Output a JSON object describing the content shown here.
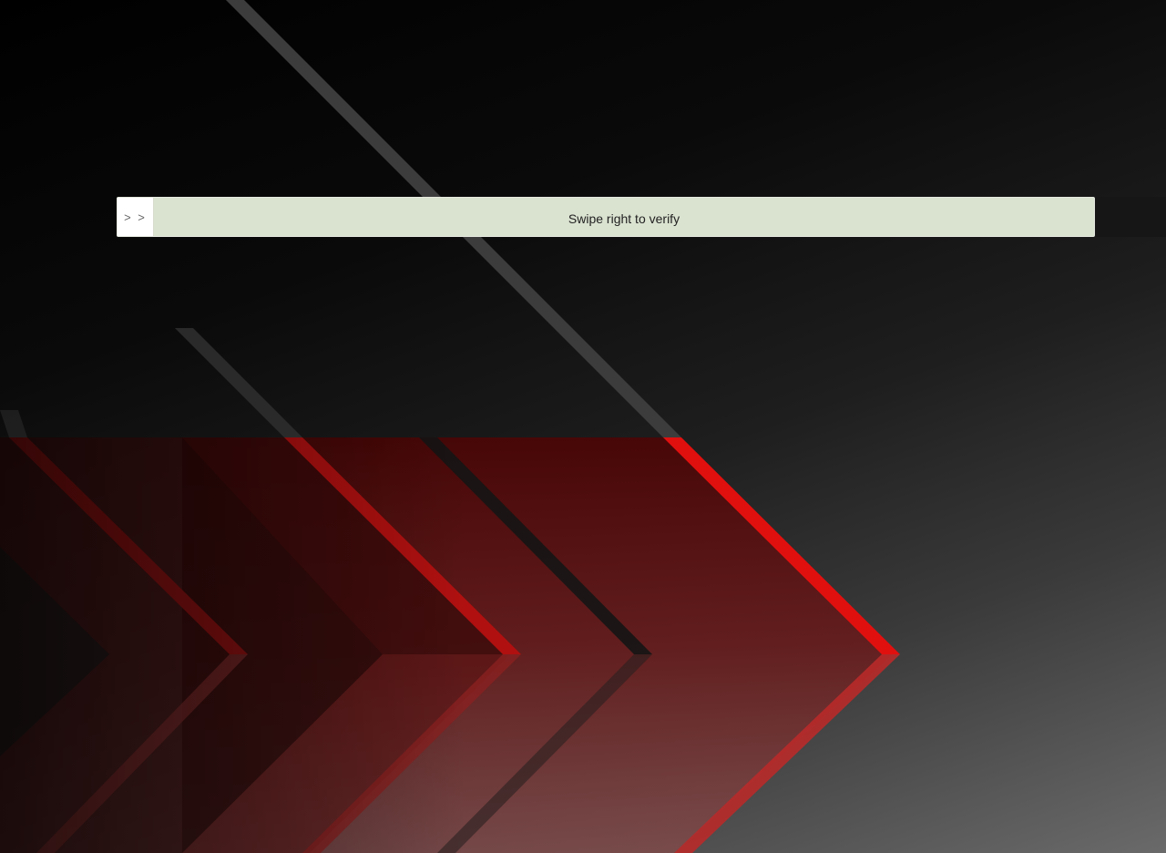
{
  "captcha": {
    "handle_icon": "double-chevron-right-icon",
    "handle_glyph": "> >",
    "instruction": "Swipe right to verify"
  },
  "background": {
    "accent_color": "#e0100f",
    "base_color": "#000000"
  }
}
